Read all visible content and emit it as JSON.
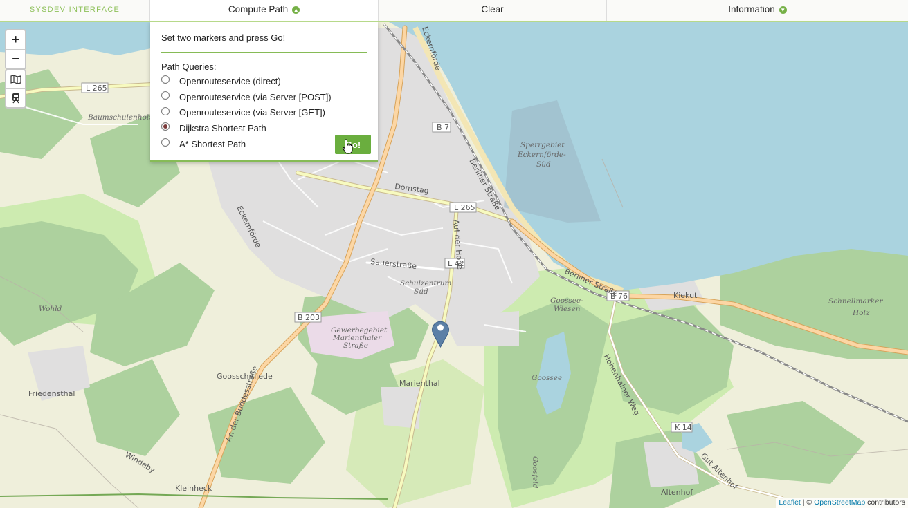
{
  "nav": {
    "brand": "SYSDEV INTERFACE",
    "compute_path": "Compute Path",
    "clear": "Clear",
    "information": "Information"
  },
  "panel": {
    "instruction": "Set two markers and press Go!",
    "queries_title": "Path Queries:",
    "options": [
      {
        "label": "Openrouteservice (direct)",
        "selected": false
      },
      {
        "label": "Openrouteservice (via Server [POST])",
        "selected": false
      },
      {
        "label": "Openrouteservice (via Server [GET])",
        "selected": false
      },
      {
        "label": "Dijkstra Shortest Path",
        "selected": true
      },
      {
        "label": "A* Shortest Path",
        "selected": false
      }
    ],
    "go_label": "Go!"
  },
  "controls": {
    "zoom_in": "+",
    "zoom_out": "−"
  },
  "map_labels": {
    "l265_a": "L 265",
    "l265_b": "L 265",
    "b7": "B 7",
    "b76": "B 76",
    "b203": "B 203",
    "l42": "L 42",
    "k14": "K 14",
    "baumschulenholz": "Baumschulenholz",
    "sperrgebiet1": "Sperrgebiet",
    "sperrgebiet2": "Eckernförde-",
    "sperrgebiet3": "Süd",
    "domstag": "Domstag",
    "berliner1": "Berliner Straße",
    "berliner2": "Berliner Straße",
    "auf_der_hone": "Auf der Hone",
    "sauerstrasse": "Sauerstraße",
    "schulzentrum1": "Schulzentrum",
    "schulzentrum2": "Süd",
    "kiekut": "Kiekut",
    "schnellmarker1": "Schnellmarker",
    "schnellmarker2": "Holz",
    "wohld": "Wohld",
    "gewerbe1": "Gewerbegebiet",
    "gewerbe2": "Marienthaler",
    "gewerbe3": "Straße",
    "goosseewiesen1": "Goossee-",
    "goosseewiesen2": "Wiesen",
    "goosschmiede": "Goosschmiede",
    "marienthal": "Marienthal",
    "friedensthal": "Friedensthal",
    "an_der_bundesstrasse": "An der Bundesstraße",
    "hohenhainer_weg": "Hohenhainer Weg",
    "goossee": "Goossee",
    "windeby": "Windeby",
    "kleinheck": "Kleinheck",
    "altenhof": "Altenhof",
    "gut_altenhof": "Gut Altenhof",
    "goosfeld": "Goosfeld",
    "eckernfoerde": "Eckernförde",
    "eckernfoerde_rd": "Eckernförde"
  },
  "attribution": {
    "leaflet": "Leaflet",
    "sep": " | © ",
    "osm": "OpenStreetMap",
    "contributors": " contributors"
  },
  "colors": {
    "accent": "#75b046",
    "water": "#aad3df",
    "forest": "#add19e",
    "residential": "#e0dfdf",
    "farmland": "#eef0d5",
    "marker": "#5b7fa6"
  }
}
